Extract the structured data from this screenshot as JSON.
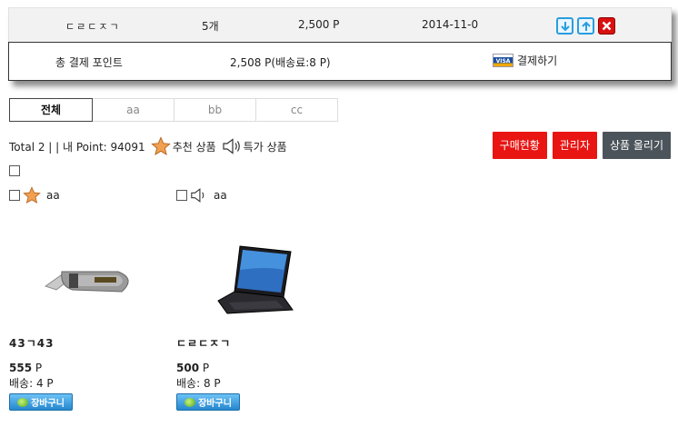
{
  "cart": {
    "item": {
      "name": "ㄷㄹㄷㅈㄱ",
      "quantity": "5개",
      "price": "2,500 P",
      "date": "2014-11-0"
    },
    "total_label": "총 결제 포인트",
    "total_value": "2,508 P(배송료:8 P)",
    "pay_label": "결제하기",
    "card_brand": "VISA"
  },
  "tabs": [
    {
      "label": "전체",
      "active": true
    },
    {
      "label": "aa",
      "active": false
    },
    {
      "label": "bb",
      "active": false
    },
    {
      "label": "cc",
      "active": false
    }
  ],
  "stats": {
    "summary": "Total 2 | | 내 Point: 94091",
    "recommended_label": "추천 상품",
    "special_label": "특가 상품"
  },
  "actions": {
    "purchase_status": "구매현황",
    "admin": "관리자",
    "upload": "상품 올리기"
  },
  "products": [
    {
      "category": "aa",
      "badge_icon": "star-icon",
      "name": "43ㄱ43",
      "price_value": "555",
      "price_unit": "P",
      "shipping": "배송: 4 P",
      "cart_label": "장바구니"
    },
    {
      "category": "aa",
      "badge_icon": "speaker-icon",
      "name": "ㄷㄹㄷㅈㄱ",
      "price_value": "500",
      "price_unit": "P",
      "shipping": "배송: 8 P",
      "cart_label": "장바구니"
    }
  ],
  "colors": {
    "accent_red": "#e81513",
    "dark_gray": "#4b545a",
    "action_blue": "#2a9de0"
  }
}
